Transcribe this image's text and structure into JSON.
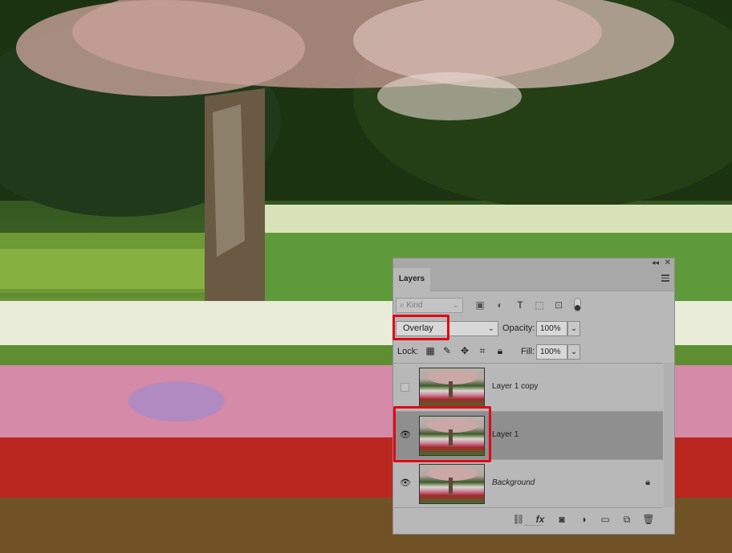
{
  "panel": {
    "tab_title": "Layers",
    "collapse_glyph": "◂◂",
    "close_glyph": "✕",
    "filter": {
      "kind_placeholder": "Kind",
      "icons": [
        "image-filter-icon",
        "adjustment-filter-icon",
        "type-filter-icon",
        "shape-filter-icon",
        "smart-object-filter-icon"
      ]
    },
    "blend_mode": "Overlay",
    "opacity_label": "Opacity:",
    "opacity_value": "100%",
    "lock_label": "Lock:",
    "fill_label": "Fill:",
    "fill_value": "100%",
    "layers": [
      {
        "name": "Layer 1 copy",
        "visible": false,
        "selected": false,
        "italic": false,
        "locked": false
      },
      {
        "name": "Layer 1",
        "visible": true,
        "selected": true,
        "italic": false,
        "locked": false
      },
      {
        "name": "Background",
        "visible": true,
        "selected": false,
        "italic": true,
        "locked": true
      }
    ],
    "footer_icons": [
      "link-layers-icon",
      "fx-icon",
      "add-mask-icon",
      "adjustment-layer-icon",
      "new-group-icon",
      "new-layer-icon",
      "delete-icon"
    ]
  },
  "colors": {
    "highlight": "#e30613",
    "panel_bg": "#b8b8b8",
    "selected_row": "#8f8f8f"
  }
}
